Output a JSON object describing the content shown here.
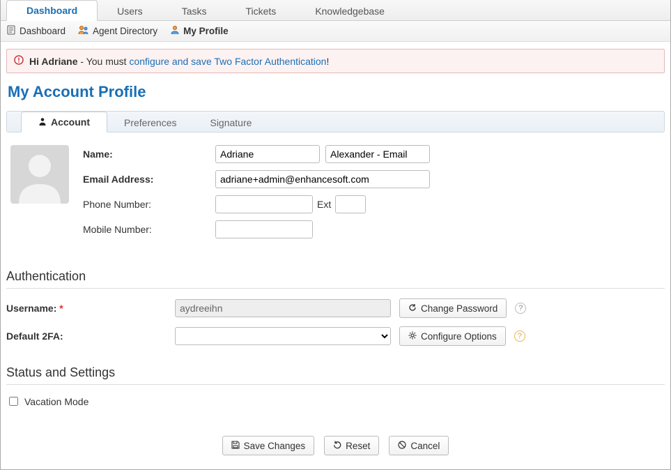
{
  "topnav": {
    "tabs": [
      {
        "label": "Dashboard",
        "active": true
      },
      {
        "label": "Users",
        "active": false
      },
      {
        "label": "Tasks",
        "active": false
      },
      {
        "label": "Tickets",
        "active": false
      },
      {
        "label": "Knowledgebase",
        "active": false
      }
    ]
  },
  "subnav": {
    "items": [
      {
        "label": "Dashboard",
        "active": false
      },
      {
        "label": "Agent Directory",
        "active": false
      },
      {
        "label": "My Profile",
        "active": true
      }
    ]
  },
  "alert": {
    "prefix": "Hi Adriane",
    "middle": " - You must ",
    "link": "configure and save Two Factor Authentication",
    "suffix": "!"
  },
  "page_title": "My Account Profile",
  "section_tabs": [
    {
      "label": "Account",
      "active": true
    },
    {
      "label": "Preferences",
      "active": false
    },
    {
      "label": "Signature",
      "active": false
    }
  ],
  "profile": {
    "labels": {
      "name": "Name:",
      "email": "Email Address:",
      "phone": "Phone Number:",
      "ext": "Ext",
      "mobile": "Mobile Number:"
    },
    "first_name": "Adriane",
    "last_name": "Alexander - Email",
    "email": "adriane+admin@enhancesoft.com",
    "phone": "",
    "ext": "",
    "mobile": ""
  },
  "auth": {
    "heading": "Authentication",
    "username_label": "Username:",
    "username": "aydreeihn",
    "change_password": "Change Password",
    "default2fa_label": "Default 2FA:",
    "configure_options": "Configure Options"
  },
  "status": {
    "heading": "Status and Settings",
    "vacation_label": "Vacation Mode"
  },
  "footer": {
    "save": "Save Changes",
    "reset": "Reset",
    "cancel": "Cancel"
  }
}
